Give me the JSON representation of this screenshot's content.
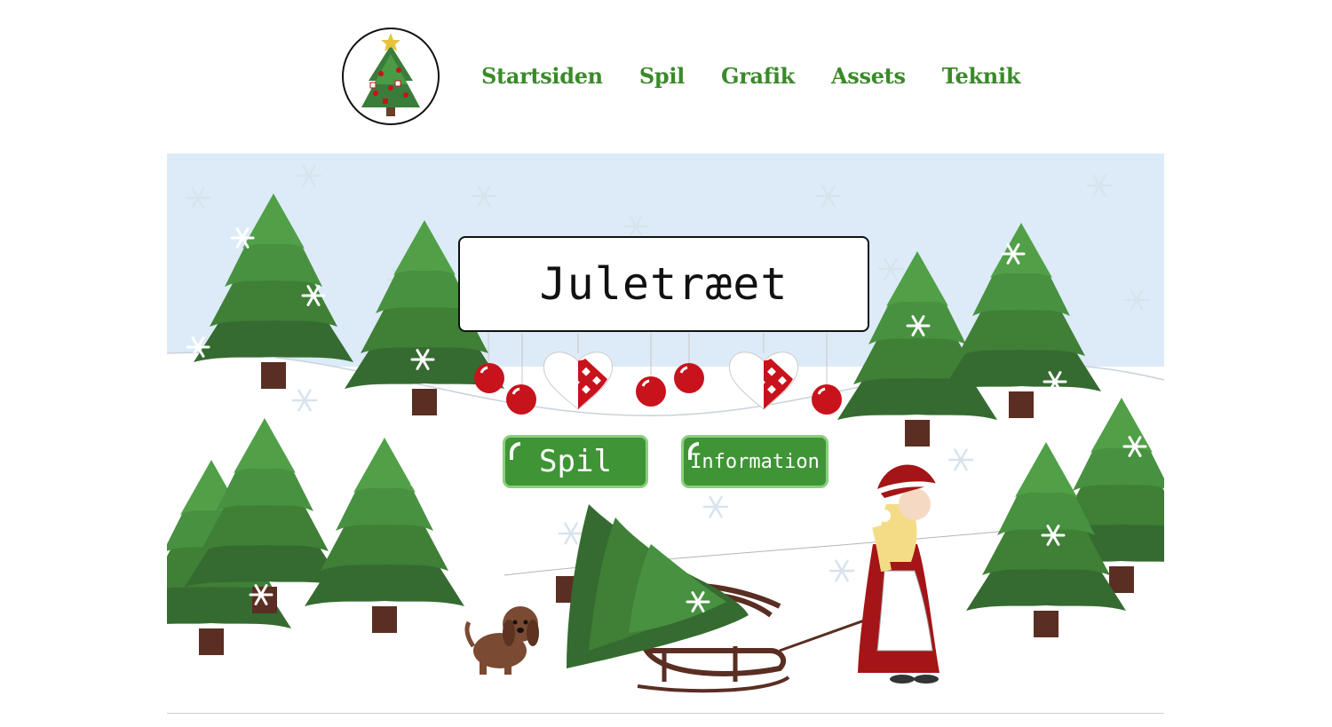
{
  "nav": {
    "items": [
      {
        "label": "Startsiden"
      },
      {
        "label": "Spil"
      },
      {
        "label": "Grafik"
      },
      {
        "label": "Assets"
      },
      {
        "label": "Teknik"
      }
    ]
  },
  "hero": {
    "title": "Juletræet",
    "buttons": {
      "play_label": "Spil",
      "info_label": "Information"
    }
  },
  "colors": {
    "nav_text": "#3a8a2a",
    "button_green": "#3f9436",
    "sky": "#dcebf7",
    "ornament_red": "#c8121c"
  },
  "icons": [
    "christmas-tree-logo-icon",
    "snowflake-icon",
    "heart-ornament-icon",
    "bauble-icon"
  ]
}
